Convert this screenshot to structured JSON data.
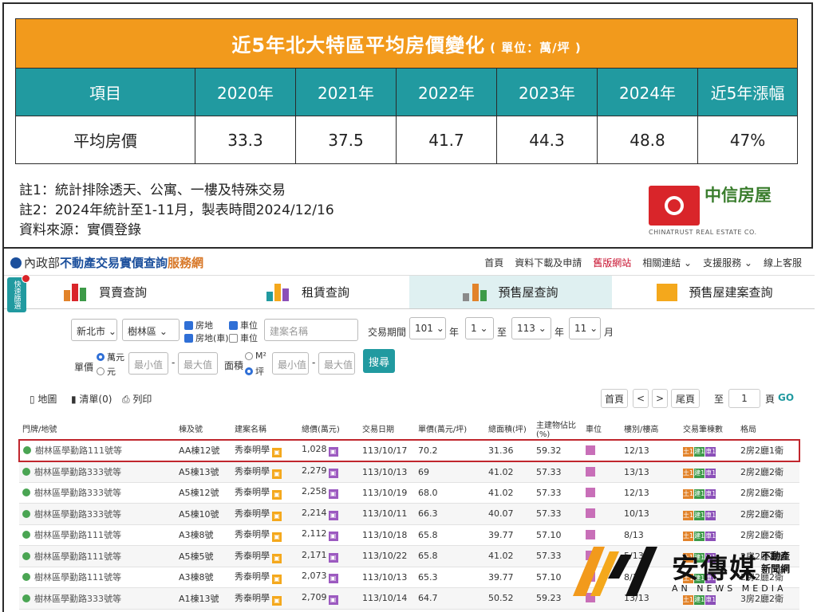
{
  "price_table": {
    "title": "近5年北大特區平均房價變化",
    "unit": "( 單位：萬/坪 )",
    "headers": [
      "項目",
      "2020年",
      "2021年",
      "2022年",
      "2023年",
      "2024年",
      "近5年漲幅"
    ],
    "row": [
      "平均房價",
      "33.3",
      "37.5",
      "41.7",
      "44.3",
      "48.8",
      "47%"
    ],
    "notes": [
      "註1：統計排除透天、公寓、一樓及特殊交易",
      "註2：2024年統計至1-11月，製表時間2024/12/16",
      "資料來源：實價登錄"
    ],
    "logo_zh": "中信房屋",
    "logo_en": "CHINATRUST REAL ESTATE CO."
  },
  "site": {
    "logo_pre": "內政部",
    "logo_main": "不動產交易實價查詢",
    "logo_suffix": "服務網",
    "nav": [
      "首頁",
      "資料下載及申請",
      "舊版網站",
      "相關連結 ⌄",
      "支援服務 ⌄",
      "線上客服"
    ],
    "side_tag": "快速篩選",
    "tabs": [
      "買賣查詢",
      "租賃查詢",
      "預售屋查詢",
      "預售屋建案查詢"
    ],
    "search": {
      "city": "新北市",
      "district": "樹林區",
      "chk_house": "房地",
      "chk_car": "車位",
      "chk_land": "房地(車)",
      "chk_radio_none": "車位",
      "project_placeholder": "建案名稱",
      "period_label": "交易期間",
      "y1": "101",
      "m1": "1",
      "to": "至",
      "y2": "113",
      "m2": "11",
      "year_unit": "年",
      "month_unit": "月",
      "price_label": "單價",
      "price_unit_a": "萬元",
      "price_unit_b": "元",
      "min_ph": "最小值",
      "max_ph": "最大值",
      "area_label": "面積",
      "area_unit_a": "M²",
      "area_unit_b": "坪",
      "dash": "-",
      "btn": "搜尋"
    },
    "toolbar": {
      "map": "地圖",
      "list": "清單(0)",
      "print": "列印",
      "first": "首頁",
      "prev": "<",
      "next": ">",
      "last": "尾頁",
      "goto": "至",
      "page": "1",
      "page_unit": "頁",
      "go": "GO"
    },
    "columns": [
      "門牌/地號",
      "棟及號",
      "建案名稱",
      "總價(萬元)",
      "交易日期",
      "單價(萬元/坪)",
      "總面積(坪)",
      "主建物佔比(%)",
      "車位",
      "樓別/樓高",
      "交易筆棟數",
      "格局"
    ],
    "rows": [
      [
        "樹林區學勤路111號等",
        "AA棟12號",
        "秀泰明學",
        "1,028",
        "113/10/17",
        "70.2",
        "31.36",
        "59.32",
        "12/13",
        "2房2廳1衛"
      ],
      [
        "樹林區學勤路333號等",
        "A5棟13號",
        "秀泰明學",
        "2,279",
        "113/10/13",
        "69",
        "41.02",
        "57.33",
        "13/13",
        "2房2廳2衛"
      ],
      [
        "樹林區學勤路333號等",
        "A5棟12號",
        "秀泰明學",
        "2,258",
        "113/10/19",
        "68.0",
        "41.02",
        "57.33",
        "12/13",
        "2房2廳2衛"
      ],
      [
        "樹林區學勤路333號等",
        "A5棟10號",
        "秀泰明學",
        "2,214",
        "113/10/11",
        "66.3",
        "40.07",
        "57.33",
        "10/13",
        "2房2廳2衛"
      ],
      [
        "樹林區學勤路111號等",
        "A3棟8號",
        "秀泰明學",
        "2,112",
        "113/10/18",
        "65.8",
        "39.77",
        "57.10",
        "8/13",
        "2房2廳2衛"
      ],
      [
        "樹林區學勤路111號等",
        "A5棟5號",
        "秀泰明學",
        "2,171",
        "113/10/22",
        "65.8",
        "41.02",
        "57.33",
        "5/13",
        "2房2廳2衛"
      ],
      [
        "樹林區學勤路111號等",
        "A3棟8號",
        "秀泰明學",
        "2,073",
        "113/10/13",
        "65.3",
        "39.77",
        "57.10",
        "8/13",
        "2房2廳2衛"
      ],
      [
        "樹林區學勤路333號等",
        "A1棟13號",
        "秀泰明學",
        "2,709",
        "113/10/14",
        "64.7",
        "50.52",
        "59.23",
        "13/13",
        "3房2廳2衛"
      ]
    ],
    "units_badge": [
      "土1",
      "建1",
      "車1"
    ]
  },
  "watermark": {
    "zh": "安傳媒",
    "zh2a": "不動產",
    "zh2b": "新聞網",
    "en": "AN NEWS MEDIA"
  },
  "colors": {
    "orange": "#f29a1c",
    "teal": "#219aa0",
    "highlight": "#c0262d"
  }
}
